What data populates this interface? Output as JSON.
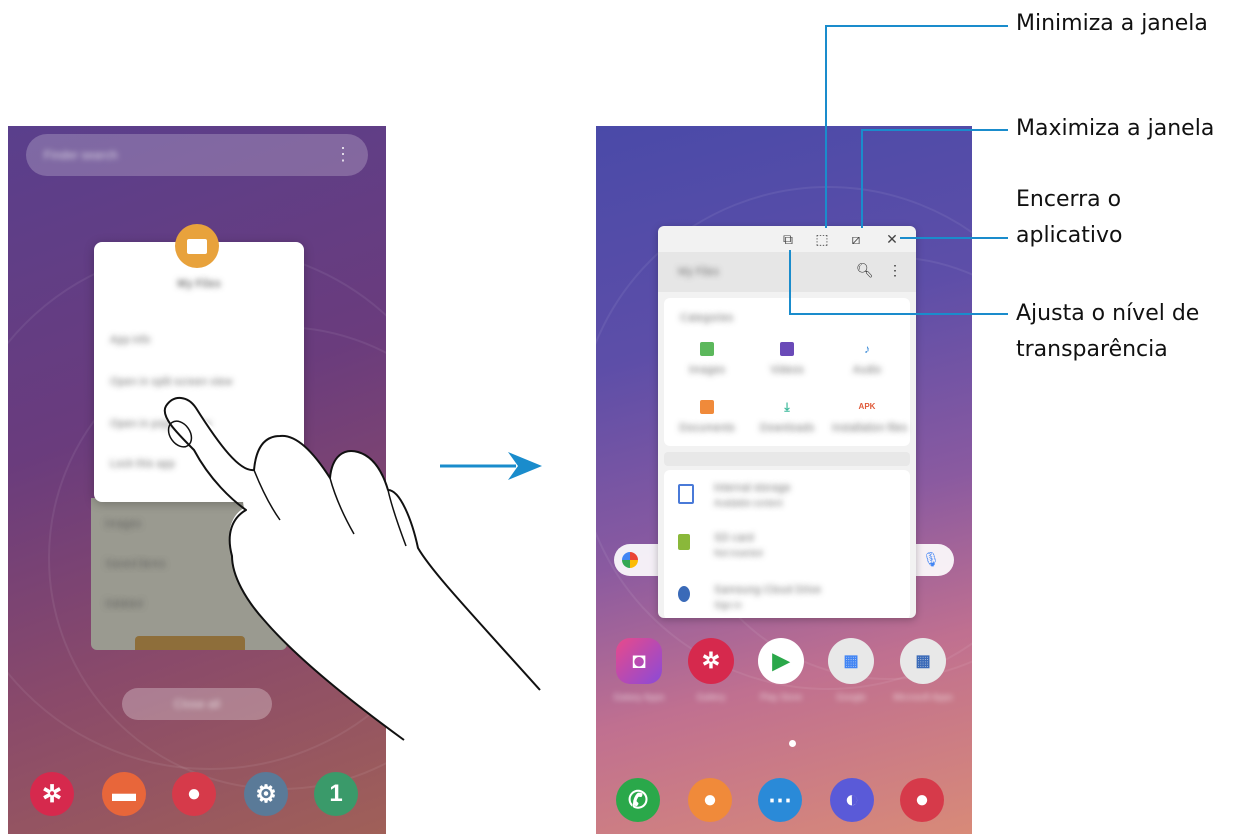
{
  "callouts": {
    "minimize": "Minimiza a janela",
    "maximize": "Maximiza a janela",
    "close_line1": "Encerra o",
    "close_line2": "aplicativo",
    "transparency_line1": "Ajusta o nível de",
    "transparency_line2": "transparência"
  },
  "colors": {
    "callout_line": "#1a8ccc",
    "arrow": "#1a8ccc"
  },
  "icons": {
    "transparency": "opacity-icon",
    "minimize": "minimize-icon",
    "maximize": "maximize-icon",
    "close": "close-icon",
    "arrow": "right-arrow-icon"
  }
}
